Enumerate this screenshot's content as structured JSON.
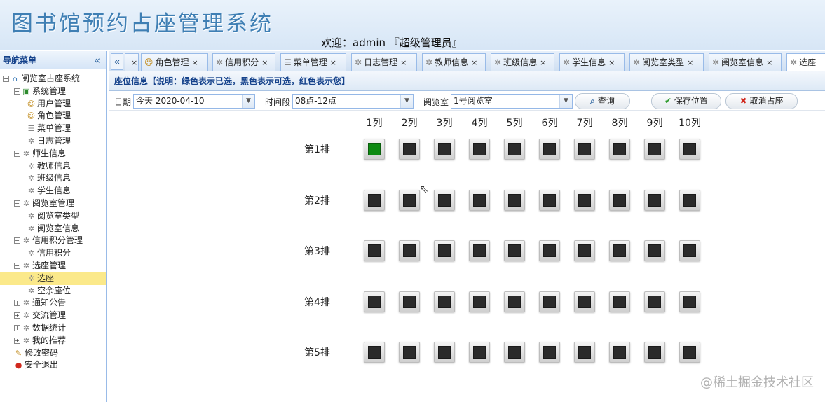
{
  "header": {
    "system_title": "图书馆预约占座管理系统",
    "welcome": "欢迎：admin 『超级管理员』"
  },
  "sidebar": {
    "title": "导航菜单",
    "collapse_icon": "double-chevron-left-icon",
    "tree": [
      {
        "label": "阅览室占座系统",
        "level": 0,
        "expander": "⊟",
        "icon": "home-icon"
      },
      {
        "label": "系统管理",
        "level": 1,
        "expander": "⊟",
        "icon": "book-icon"
      },
      {
        "label": "用户管理",
        "level": 2,
        "icon": "users-icon"
      },
      {
        "label": "角色管理",
        "level": 2,
        "icon": "users-icon"
      },
      {
        "label": "菜单管理",
        "level": 2,
        "icon": "menu-icon"
      },
      {
        "label": "日志管理",
        "level": 2,
        "icon": "gear-icon"
      },
      {
        "label": "师生信息",
        "level": 1,
        "expander": "⊟",
        "icon": "gear-icon"
      },
      {
        "label": "教师信息",
        "level": 2,
        "icon": "gear-icon"
      },
      {
        "label": "班级信息",
        "level": 2,
        "icon": "gear-icon"
      },
      {
        "label": "学生信息",
        "level": 2,
        "icon": "gear-icon"
      },
      {
        "label": "阅览室管理",
        "level": 1,
        "expander": "⊟",
        "icon": "gear-icon"
      },
      {
        "label": "阅览室类型",
        "level": 2,
        "icon": "gear-icon"
      },
      {
        "label": "阅览室信息",
        "level": 2,
        "icon": "gear-icon"
      },
      {
        "label": "信用积分管理",
        "level": 1,
        "expander": "⊟",
        "icon": "gear-icon"
      },
      {
        "label": "信用积分",
        "level": 2,
        "icon": "gear-icon"
      },
      {
        "label": "选座管理",
        "level": 1,
        "expander": "⊟",
        "icon": "gear-icon"
      },
      {
        "label": "选座",
        "level": 2,
        "icon": "gear-icon",
        "selected": true
      },
      {
        "label": "空余座位",
        "level": 2,
        "icon": "gear-icon"
      },
      {
        "label": "通知公告",
        "level": 1,
        "expander": "⊞",
        "icon": "gear-icon"
      },
      {
        "label": "交流管理",
        "level": 1,
        "expander": "⊞",
        "icon": "gear-icon"
      },
      {
        "label": "数据统计",
        "level": 1,
        "expander": "⊞",
        "icon": "gear-icon"
      },
      {
        "label": "我的推荐",
        "level": 1,
        "expander": "⊞",
        "icon": "gear-icon"
      },
      {
        "label": "修改密码",
        "level": 1,
        "icon": "key-icon"
      },
      {
        "label": "安全退出",
        "level": 1,
        "icon": "exit-icon"
      }
    ]
  },
  "tabs": {
    "scroll_icon": "double-chevron-left-icon",
    "items": [
      {
        "label": "",
        "icon": ""
      },
      {
        "label": "角色管理",
        "icon": "users-icon"
      },
      {
        "label": "信用积分",
        "icon": "gear-icon"
      },
      {
        "label": "菜单管理",
        "icon": "menu-icon"
      },
      {
        "label": "日志管理",
        "icon": "gear-icon"
      },
      {
        "label": "教师信息",
        "icon": "gear-icon"
      },
      {
        "label": "班级信息",
        "icon": "gear-icon"
      },
      {
        "label": "学生信息",
        "icon": "gear-icon"
      },
      {
        "label": "阅览室类型",
        "icon": "gear-icon"
      },
      {
        "label": "阅览室信息",
        "icon": "gear-icon"
      },
      {
        "label": "选座",
        "icon": "gear-icon",
        "active": true
      }
    ]
  },
  "seat_panel": {
    "title": "座位信息【说明：绿色表示已选，黑色表示可选，红色表示您】",
    "date_label": "日期",
    "date_value": "今天  2020-04-10",
    "period_label": "时间段",
    "period_value": "08点-12点",
    "room_label": "阅览室",
    "room_value": "1号阅览室",
    "search_button": "查询",
    "save_button": "保存位置",
    "cancel_button": "取消占座",
    "columns": [
      "1列",
      "2列",
      "3列",
      "4列",
      "5列",
      "6列",
      "7列",
      "8列",
      "9列",
      "10列"
    ],
    "rows": [
      "第1排",
      "第2排",
      "第3排",
      "第4排",
      "第5排"
    ],
    "seat_status": [
      [
        "taken",
        "free",
        "free",
        "free",
        "free",
        "free",
        "free",
        "free",
        "free",
        "free"
      ],
      [
        "free",
        "free",
        "free",
        "free",
        "free",
        "free",
        "free",
        "free",
        "free",
        "free"
      ],
      [
        "free",
        "free",
        "free",
        "free",
        "free",
        "free",
        "free",
        "free",
        "free",
        "free"
      ],
      [
        "free",
        "free",
        "free",
        "free",
        "free",
        "free",
        "free",
        "free",
        "free",
        "free"
      ],
      [
        "free",
        "free",
        "free",
        "free",
        "free",
        "free",
        "free",
        "free",
        "free",
        "free"
      ]
    ],
    "colors": {
      "taken": "#0e8a12",
      "free": "#2b2b2b",
      "mine": "#c0261d"
    }
  },
  "watermark": "@稀土掘金技术社区"
}
